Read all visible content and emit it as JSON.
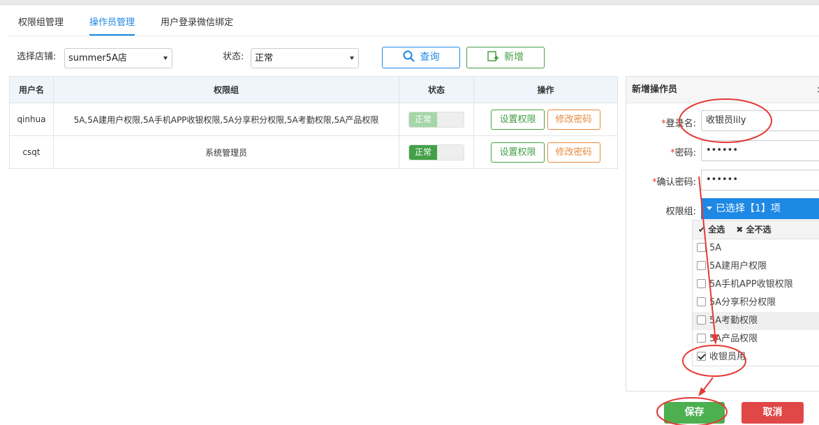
{
  "tabs": [
    {
      "label": "权限组管理"
    },
    {
      "label": "操作员管理"
    },
    {
      "label": "用户登录微信绑定"
    }
  ],
  "filters": {
    "shop_label": "选择店铺:",
    "shop_value": "summer5A店",
    "status_label": "状态:",
    "status_value": "正常",
    "query_label": "查询",
    "add_label": "新增"
  },
  "table": {
    "headers": [
      "用户名",
      "权限组",
      "状态",
      "操作"
    ],
    "rows": [
      {
        "username": "qinhua",
        "groups": "5A,5A建用户权限,5A手机APP收银权限,5A分享积分权限,5A考勤权限,5A产品权限",
        "status": "正常",
        "set_perm": "设置权限",
        "change_pwd": "修改密码"
      },
      {
        "username": "csqt",
        "groups": "系统管理员",
        "status": "正常",
        "set_perm": "设置权限",
        "change_pwd": "修改密码"
      }
    ]
  },
  "panel": {
    "title": "新增操作员",
    "close": "×",
    "login_label": "登录名:",
    "login_value": "收银员lily",
    "pwd_label": "密码:",
    "pwd_value": "••••••",
    "confirm_label": "确认密码:",
    "confirm_value": "••••••",
    "group_label": "权限组:",
    "required_mark": "*",
    "dropdown_text": "已选择【1】项",
    "select_all": "全选",
    "select_none": "全不选",
    "options": [
      {
        "label": "5A",
        "checked": false
      },
      {
        "label": "5A建用户权限",
        "checked": false
      },
      {
        "label": "5A手机APP收银权限",
        "checked": false
      },
      {
        "label": "5A分享积分权限",
        "checked": false
      },
      {
        "label": "5A考勤权限",
        "checked": false
      },
      {
        "label": "5A产品权限",
        "checked": false
      },
      {
        "label": "收银员用",
        "checked": true
      }
    ]
  },
  "buttons": {
    "save": "保存",
    "cancel": "取消"
  },
  "colors": {
    "accent_blue": "#1e88e5",
    "green": "#43a047",
    "orange": "#e8893a",
    "red": "#e04848",
    "annotation_red": "#e53935"
  }
}
